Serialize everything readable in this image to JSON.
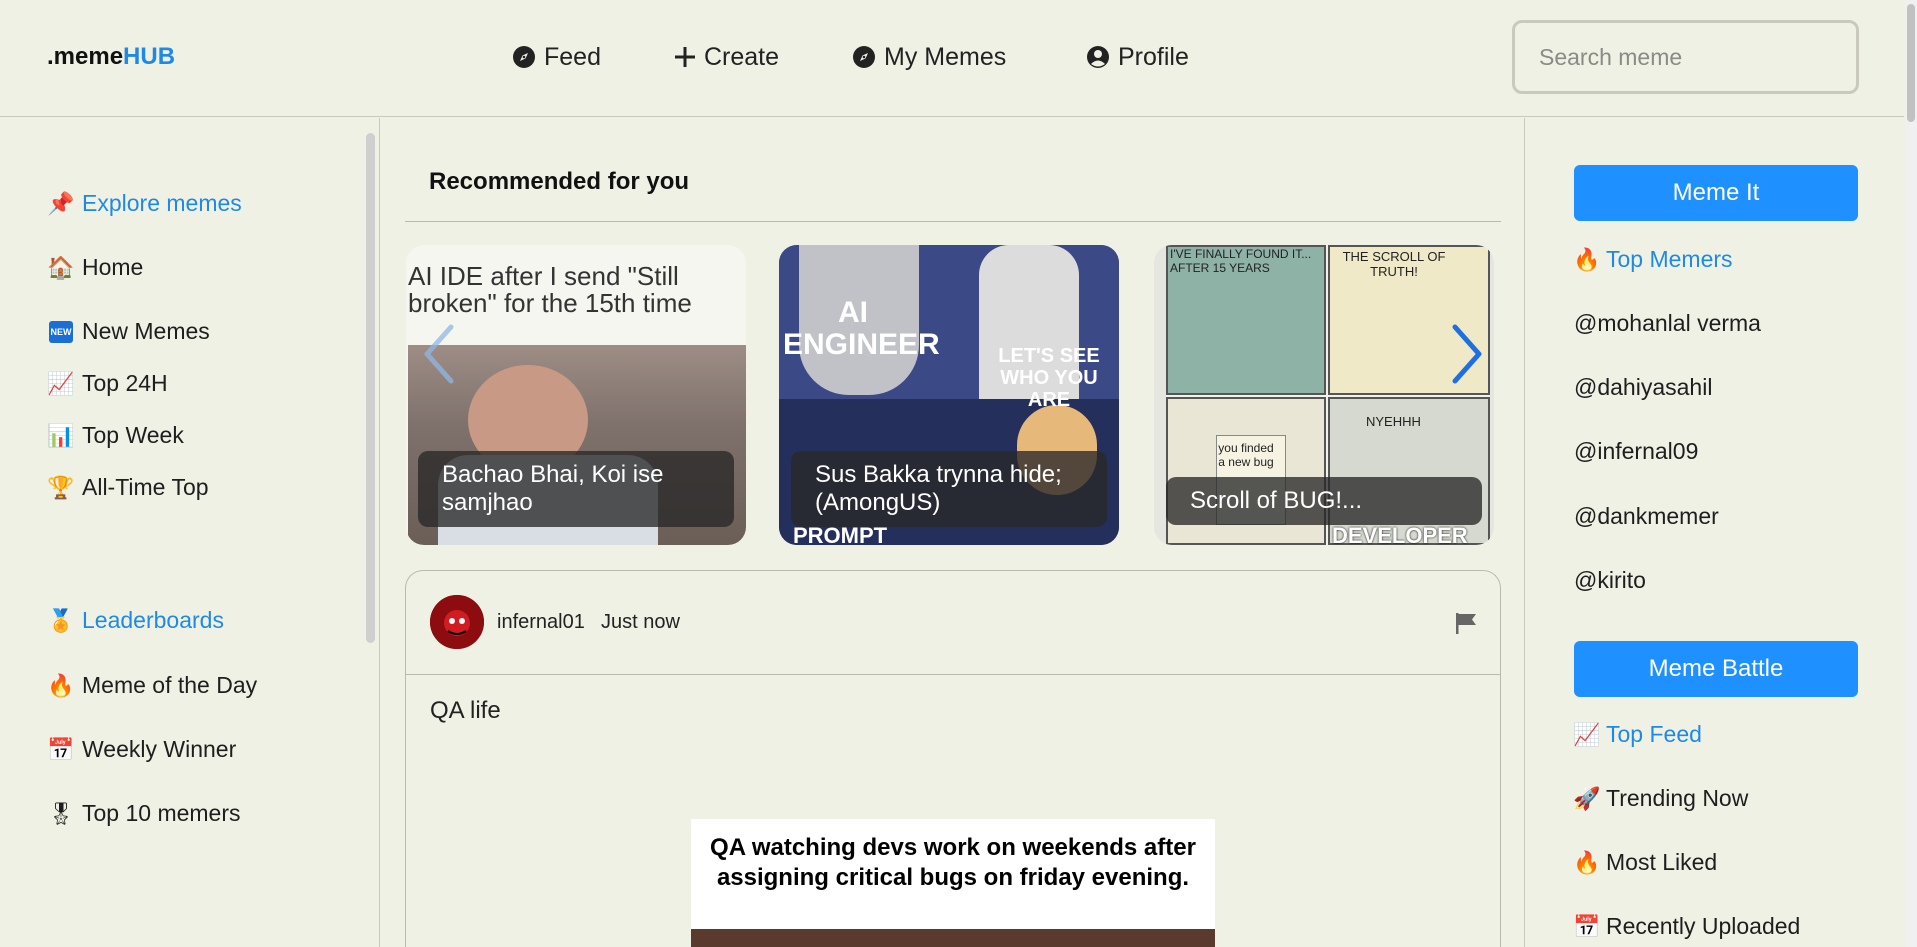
{
  "header": {
    "logo_prefix": ".meme",
    "logo_suffix": "HUB",
    "nav": [
      {
        "label": "Feed",
        "icon": "compass-icon"
      },
      {
        "label": "Create",
        "icon": "plus-icon"
      },
      {
        "label": "My Memes",
        "icon": "compass-icon"
      },
      {
        "label": "Profile",
        "icon": "user-circle-icon"
      }
    ],
    "search_placeholder": "Search meme"
  },
  "left_sidebar": {
    "explore": {
      "label": "Explore memes",
      "icon": "pushpin-icon"
    },
    "explore_items": [
      {
        "label": "Home",
        "icon": "house-icon"
      },
      {
        "label": "New Memes",
        "icon": "new-badge-icon"
      },
      {
        "label": "Top 24H",
        "icon": "chart-increasing-icon"
      },
      {
        "label": "Top Week",
        "icon": "bar-chart-icon"
      },
      {
        "label": "All-Time Top",
        "icon": "trophy-icon"
      }
    ],
    "leaderboards": {
      "label": "Leaderboards",
      "icon": "medal-icon"
    },
    "leaderboard_items": [
      {
        "label": "Meme of the Day",
        "icon": "fire-icon"
      },
      {
        "label": "Weekly Winner",
        "icon": "calendar-icon"
      },
      {
        "label": "Top 10 memers",
        "icon": "medal-icon"
      }
    ]
  },
  "main": {
    "recommended_title": "Recommended for you",
    "cards": [
      {
        "caption": "Bachao Bhai, Koi ise samjhao",
        "image_top_text": "AI IDE after I send \"Still broken\" for the 15th time"
      },
      {
        "caption": "Sus Bakka trynna hide; (AmongUS)",
        "image_texts": [
          "AI ENGINEER",
          "LET'S SEE WHO YOU ARE",
          "PROMPT"
        ]
      },
      {
        "caption": "Scroll of BUG!...",
        "image_texts": [
          "I'VE FINALLY FOUND IT... AFTER 15 YEARS",
          "THE SCROLL OF TRUTH!",
          "you finded a new bug",
          "NYEHHH",
          "DEVELOPER"
        ]
      }
    ],
    "post": {
      "author": "infernal01",
      "time": "Just now",
      "text": "QA life",
      "image_caption": "QA watching devs work on weekends after assigning critical bugs on friday evening."
    }
  },
  "right_sidebar": {
    "meme_it_label": "Meme It",
    "top_memers": {
      "label": "Top Memers",
      "icon": "fire-icon"
    },
    "memers": [
      "@mohanlal verma",
      "@dahiyasahil",
      "@infernal09",
      "@dankmemer",
      "@kirito"
    ],
    "meme_battle_label": "Meme Battle",
    "top_feed": {
      "label": "Top Feed",
      "icon": "chart-increasing-icon"
    },
    "feed_items": [
      {
        "label": "Trending Now",
        "icon": "rocket-icon"
      },
      {
        "label": "Most Liked",
        "icon": "fire-icon"
      },
      {
        "label": "Recently Uploaded",
        "icon": "calendar-icon"
      }
    ]
  },
  "colors": {
    "accent": "#1f8ae4",
    "button": "#1e90ff",
    "background": "#f0f1e5"
  }
}
